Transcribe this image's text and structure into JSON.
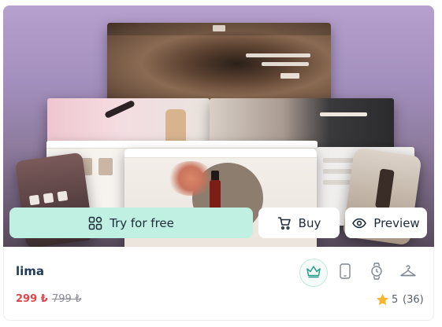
{
  "product": {
    "name": "lima",
    "price": "299 ₺",
    "old_price": "799 ₺",
    "rating": "5",
    "rating_count": "(36)"
  },
  "actions": {
    "try_label": "Try for free",
    "buy_label": "Buy",
    "preview_label": "Preview"
  },
  "icons": {
    "try": "apps-grid-icon",
    "buy": "cart-icon",
    "preview": "eye-icon",
    "platforms": [
      "crown-icon",
      "mobile-phone-icon",
      "smartwatch-icon",
      "clothes-hanger-icon"
    ],
    "rating": "star-icon"
  },
  "colors": {
    "accent_mint": "#bff0e1",
    "price_red": "#e2444c",
    "title_navy": "#1f3b55",
    "star_gold": "#f5b731"
  }
}
